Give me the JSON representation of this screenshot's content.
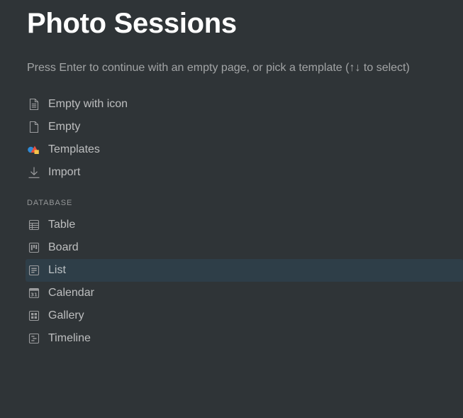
{
  "page": {
    "title": "Photo Sessions",
    "hint": "Press Enter to continue with an empty page, or pick a template (↑↓ to select)"
  },
  "options": [
    {
      "label": "Empty with icon",
      "icon": "document-text-icon"
    },
    {
      "label": "Empty",
      "icon": "document-blank-icon"
    },
    {
      "label": "Templates",
      "icon": "templates-shapes-icon"
    },
    {
      "label": "Import",
      "icon": "download-arrow-icon"
    }
  ],
  "database": {
    "header": "DATABASE",
    "items": [
      {
        "label": "Table",
        "icon": "table-icon"
      },
      {
        "label": "Board",
        "icon": "board-icon"
      },
      {
        "label": "List",
        "icon": "list-icon",
        "selected": true
      },
      {
        "label": "Calendar",
        "icon": "calendar-icon"
      },
      {
        "label": "Gallery",
        "icon": "gallery-icon"
      },
      {
        "label": "Timeline",
        "icon": "timeline-icon"
      }
    ]
  },
  "colors": {
    "background": "#2f3437",
    "selected_row": "#2e3e48",
    "icon_gray": "#9b9c9e"
  }
}
